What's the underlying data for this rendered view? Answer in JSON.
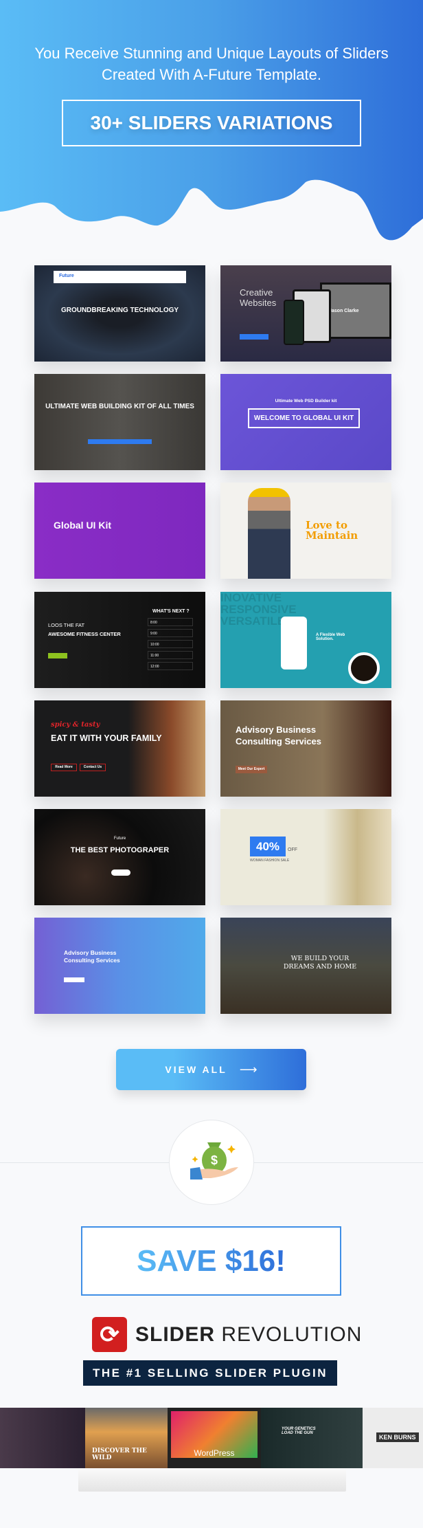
{
  "hero": {
    "line1": "You Receive Stunning and Unique Layouts of Sliders",
    "line2": "Created With A-Future Template.",
    "badge": "30+ SLIDERS VARIATIONS",
    "gradient": [
      "#5abcf6",
      "#2e6ed9"
    ]
  },
  "thumbnails": [
    {
      "title": "GROUNDBREAKING TECHNOLOGY",
      "brand": "Future"
    },
    {
      "title": "Creative Websites",
      "extra": "Jason Clarke"
    },
    {
      "title": "ULTIMATE WEB BUILDING KIT OF ALL TIMES"
    },
    {
      "subtitle": "Ultimate Web PSD Builder kit",
      "title": "WELCOME TO GLOBAL UI KIT"
    },
    {
      "title": "Global UI Kit"
    },
    {
      "title": "Love to Maintain"
    },
    {
      "title": "LOOS THE FAT",
      "title2": "AWESOME FITNESS CENTER",
      "side": "WHAT'S NEXT ?",
      "times": [
        "8:00",
        "9:00",
        "10:00",
        "11:00",
        "12:00"
      ]
    },
    {
      "bg": "INOVATIVE RESPONSIVE VERSATILE",
      "title": "A Flexible Web Solution."
    },
    {
      "script": "spicy & tasty",
      "title": "EAT IT WITH YOUR FAMILY",
      "buttons": [
        "Read More",
        "Contact Us"
      ]
    },
    {
      "title": "Advisory Business Consulting Services",
      "button": "Meet Our Expert"
    },
    {
      "title": "THE BEST PHOTOGRAPER",
      "brand": "Future"
    },
    {
      "badge": "40%",
      "off": "OFF",
      "title": "WOMAN FASHION SALE"
    },
    {
      "title": "Advisory Business Consulting Services"
    },
    {
      "title": "WE BUILD YOUR DREAMS AND HOME"
    }
  ],
  "view_all": {
    "label": "VIEW ALL",
    "icon": "arrow-right-icon"
  },
  "money_icon": "money-bag-hand-icon",
  "save": {
    "label": "SAVE $16!"
  },
  "plugin": {
    "name_bold": "SLIDER",
    "name_light": "REVOLUTION",
    "tagline": "THE #1 SELLING SLIDER PLUGIN",
    "brand_color": "#d21f1f"
  },
  "showcase": {
    "center": "WordPress",
    "left": "DISCOVER THE WILD",
    "right": "YOUR GENETICS LOAD THE GUN",
    "far_right": "KEN BURNS"
  }
}
